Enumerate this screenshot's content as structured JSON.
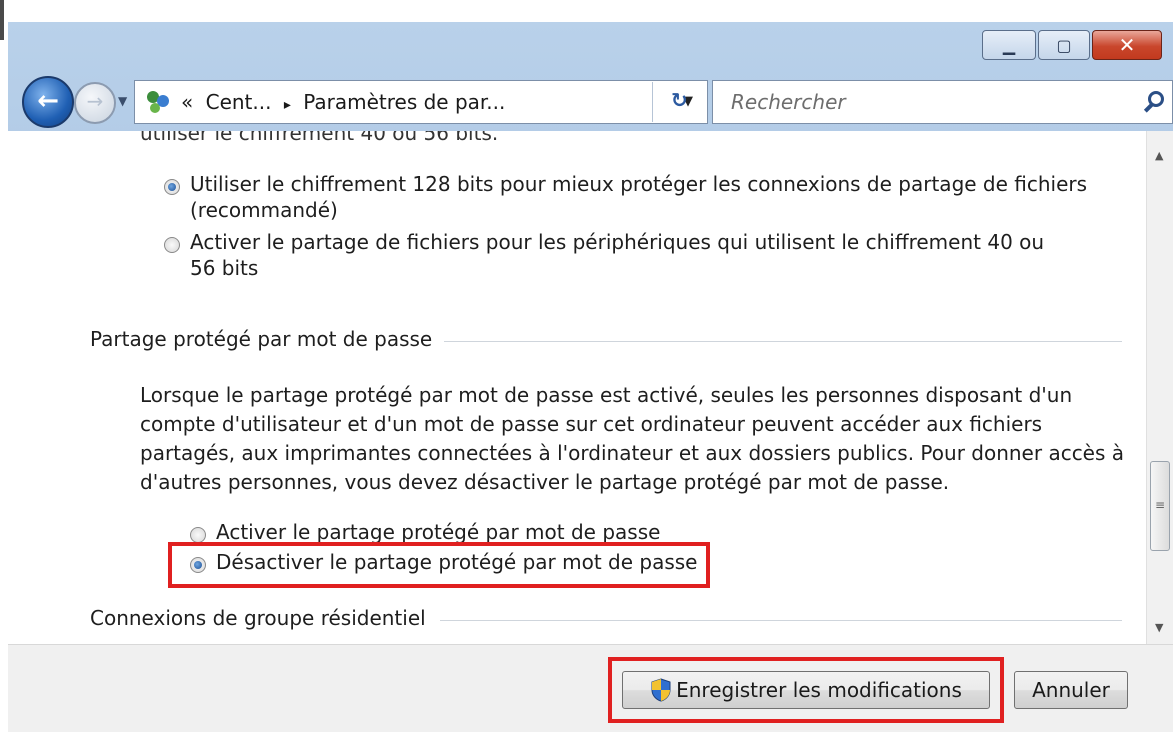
{
  "window": {
    "minimize_glyph": "▁",
    "maximize_glyph": "▢",
    "close_glyph": "✕"
  },
  "nav": {
    "back_glyph": "←",
    "forward_glyph": "→",
    "dropdown_glyph": "▼"
  },
  "address": {
    "overflow_glyph": "«",
    "crumb_1": "Cent...",
    "separator": "▸",
    "crumb_2": "Paramètres de par...",
    "dropdown_glyph": "▼",
    "refresh_glyph": "↻"
  },
  "search": {
    "placeholder": "Rechercher"
  },
  "content": {
    "cut_off_text": "utiliser le chiffrement 40 ou 56 bits.",
    "encryption_options": [
      {
        "label": "Utiliser le chiffrement 128 bits pour mieux protéger les connexions de partage de fichiers (recommandé)",
        "selected": true
      },
      {
        "label": "Activer le partage de fichiers pour les périphériques qui utilisent le chiffrement 40 ou 56 bits",
        "selected": false
      }
    ],
    "password_section": {
      "title": "Partage protégé par mot de passe",
      "description": "Lorsque le partage protégé par mot de passe est activé, seules les personnes disposant d'un compte d'utilisateur et d'un mot de passe sur cet ordinateur peuvent accéder aux fichiers partagés, aux imprimantes connectées à l'ordinateur et aux dossiers publics. Pour donner accès à d'autres personnes, vous devez désactiver le partage protégé par mot de passe.",
      "options": [
        {
          "label": "Activer le partage protégé par mot de passe",
          "selected": false
        },
        {
          "label": "Désactiver le partage protégé par mot de passe",
          "selected": true
        }
      ]
    },
    "homegroup_section": {
      "title": "Connexions de groupe résidentiel"
    }
  },
  "scrollbar": {
    "up_glyph": "▲",
    "down_glyph": "▼",
    "grip_glyph": "≡"
  },
  "buttons": {
    "save": "Enregistrer les modifications",
    "cancel": "Annuler"
  },
  "colors": {
    "highlight_box": "#e02020",
    "title_bar": "#b9d1ea"
  }
}
